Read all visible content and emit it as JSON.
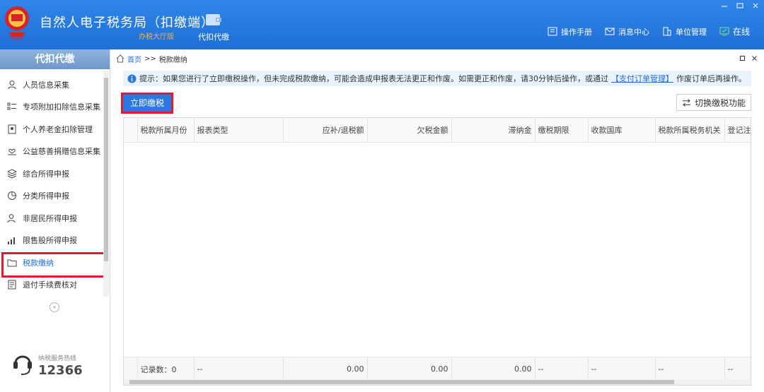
{
  "header": {
    "title": "自然人电子税务局（扣缴端）",
    "subtitle": "办税大厅版",
    "module_label": "代扣代缴",
    "links": [
      {
        "label": "操作手册",
        "icon": "book-icon"
      },
      {
        "label": "消息中心",
        "icon": "mail-icon"
      },
      {
        "label": "单位管理",
        "icon": "building-icon"
      }
    ],
    "status": "在线",
    "colors": {
      "bar": "#1f6fd6",
      "subtitle": "#f4b33a",
      "online": "#7fe07f"
    }
  },
  "sidebar": {
    "title": "代扣代缴",
    "items": [
      {
        "label": "人员信息采集",
        "icon": "person-icon"
      },
      {
        "label": "专项附加扣除信息采集",
        "icon": "list-icon"
      },
      {
        "label": "个人养老金扣除管理",
        "icon": "badge-icon"
      },
      {
        "label": "公益慈善捐赠信息采集",
        "icon": "heart-hand-icon"
      },
      {
        "label": "综合所得申报",
        "icon": "layers-icon"
      },
      {
        "label": "分类所得申报",
        "icon": "pie-icon"
      },
      {
        "label": "非居民所得申报",
        "icon": "user-outline-icon"
      },
      {
        "label": "限售股所得申报",
        "icon": "bar-chart-icon"
      },
      {
        "label": "税款缴纳",
        "icon": "folder-icon",
        "active": true
      },
      {
        "label": "退付手续费核对",
        "icon": "document-icon"
      }
    ],
    "hotline_label": "纳税服务热线",
    "hotline_number": "12366"
  },
  "breadcrumb": {
    "home": "首页",
    "separator": ">>",
    "current": "税款缴纳"
  },
  "tip": {
    "prefix": "提示：如果您进行了立即缴税操作，但未完成税款缴纳，可能会造成申报表无法更正和作废。如需更正和作废，请30分钟后操作，或通过",
    "link": "【支付订单管理】",
    "suffix": "作废订单后再操作。"
  },
  "toolbar": {
    "pay_now": "立即缴税",
    "switch": "切换缴税功能"
  },
  "table": {
    "columns": [
      "税款所属月份",
      "报表类型",
      "应补/退税额",
      "欠税金额",
      "滞纳金",
      "缴税期限",
      "收款国库",
      "税款所属税务机关",
      "登记注"
    ],
    "footer": [
      "记录数：0",
      "--",
      "0.00",
      "0.00",
      "0.00",
      "--",
      "--",
      "--",
      "--"
    ]
  }
}
